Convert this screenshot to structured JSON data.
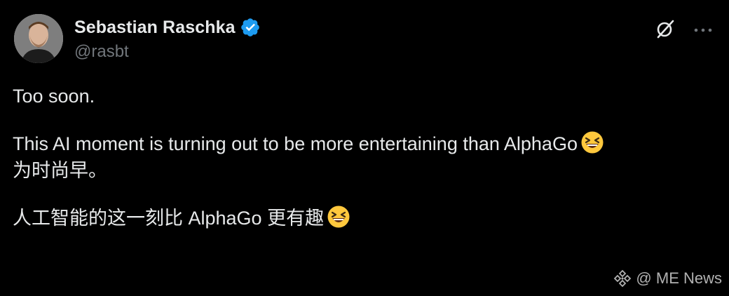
{
  "author": {
    "display_name": "Sebastian Raschka",
    "handle": "@rasbt",
    "verified": true,
    "avatar_icon": "person-photo"
  },
  "actions": {
    "grok_icon": "grok-icon",
    "more_icon": "more-dots-icon"
  },
  "post": {
    "line1": "Too soon.",
    "line2": "This AI moment is turning out to be more entertaining than AlphaGo",
    "line3": "为时尚早。",
    "line4": "人工智能的这一刻比 AlphaGo 更有趣",
    "emoji": "grinning-squinting-face"
  },
  "watermark": {
    "text": "@ ME News"
  },
  "colors": {
    "background": "#000000",
    "text_primary": "#e7e9ea",
    "text_secondary": "#71767b",
    "verified_badge": "#1d9bf0",
    "emoji_fill": "#ffc83d"
  }
}
